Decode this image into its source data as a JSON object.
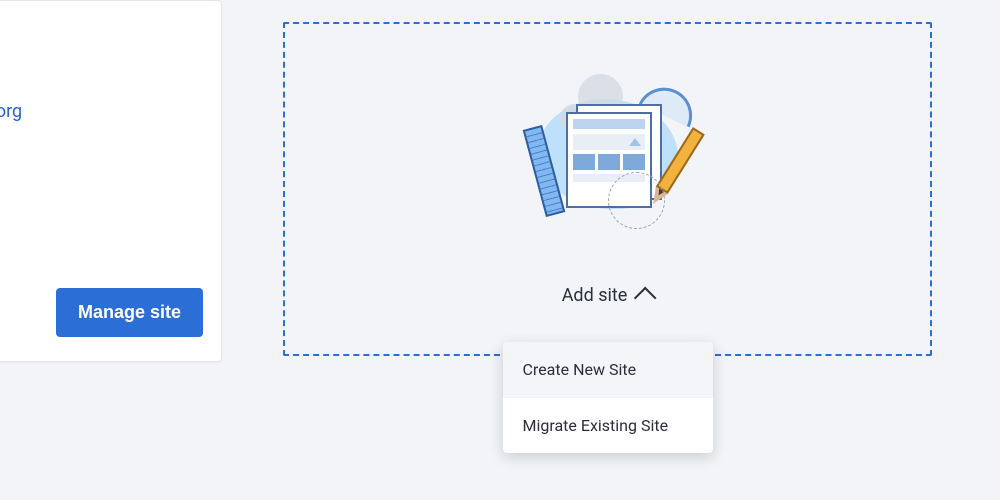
{
  "site_card": {
    "domain_fragment": "g.org",
    "manage_button_label": "Manage site"
  },
  "add_site": {
    "trigger_label": "Add site",
    "menu": {
      "create_label": "Create New Site",
      "migrate_label": "Migrate Existing Site"
    }
  }
}
